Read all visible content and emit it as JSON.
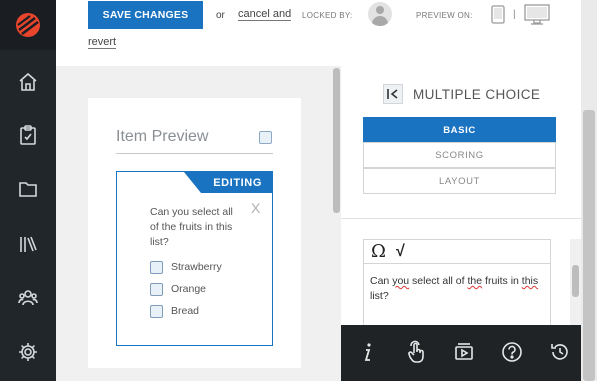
{
  "toolbar": {
    "save_label": "SAVE CHANGES",
    "or_text": "or",
    "cancel_label": "cancel and",
    "revert_label": "revert",
    "locked_by_label": "LOCKED BY:",
    "preview_on_label": "PREVIEW ON:",
    "separator": "|"
  },
  "sidebar": {
    "items": [
      {
        "icon": "home-icon"
      },
      {
        "icon": "clipboard-icon"
      },
      {
        "icon": "folder-icon"
      },
      {
        "icon": "library-icon"
      },
      {
        "icon": "users-icon"
      },
      {
        "icon": "gear-icon"
      }
    ]
  },
  "preview": {
    "title": "Item Preview",
    "editing_tag": "EDITING",
    "close_glyph": "X",
    "question": "Can you select all of the fruits in this list?",
    "options": [
      "Strawberry",
      "Orange",
      "Bread"
    ]
  },
  "editor_panel": {
    "title": "MULTIPLE CHOICE",
    "tabs": [
      {
        "label": "BASIC",
        "active": true
      },
      {
        "label": "SCORING",
        "active": false
      },
      {
        "label": "LAYOUT",
        "active": false
      }
    ],
    "toolbar_glyphs": {
      "omega": "Ω",
      "sqrt": "√"
    },
    "text_parts": [
      "Can ",
      "you",
      " select all of ",
      "the",
      " fruits in ",
      "this",
      " list?"
    ]
  },
  "bottom_toolbar": {
    "buttons": [
      "info-icon",
      "touch-icon",
      "media-icon",
      "help-icon",
      "history-icon"
    ]
  },
  "colors": {
    "accent": "#1a73c1",
    "sidebar_bg": "#21262b",
    "bottom_bar_bg": "#1f2326",
    "logo": "#e8452c"
  }
}
